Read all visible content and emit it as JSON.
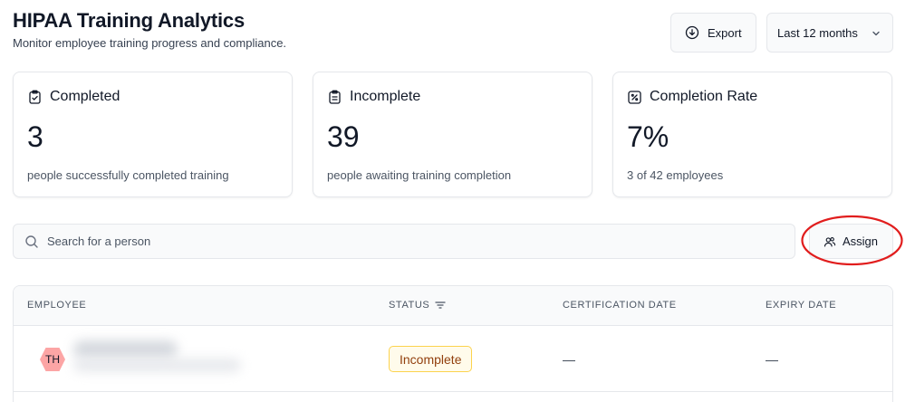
{
  "header": {
    "title": "HIPAA Training Analytics",
    "subtitle": "Monitor employee training progress and compliance."
  },
  "toolbar": {
    "export_label": "Export",
    "date_range": {
      "selected": "Last 12 months"
    }
  },
  "stats": [
    {
      "title": "Completed",
      "value": "3",
      "caption": "people successfully completed training",
      "icon": "clipboard-check-icon"
    },
    {
      "title": "Incomplete",
      "value": "39",
      "caption": "people awaiting training completion",
      "icon": "clipboard-list-icon"
    },
    {
      "title": "Completion Rate",
      "value": "7%",
      "caption": "3 of 42 employees",
      "icon": "percent-square-icon"
    }
  ],
  "search": {
    "placeholder": "Search for a person",
    "value": ""
  },
  "assign": {
    "label": "Assign"
  },
  "annotation": {
    "color": "#e11d1d"
  },
  "table": {
    "columns": [
      "EMPLOYEE",
      "STATUS",
      "CERTIFICATION DATE",
      "EXPIRY DATE"
    ],
    "rows": [
      {
        "initials": "TH",
        "status": "Incomplete",
        "certification_date": "—",
        "expiry_date": "—"
      }
    ]
  },
  "colors": {
    "avatar_fill": "#fca5a5",
    "badge_bg": "#fffbeb",
    "badge_border": "#fcd34d",
    "badge_text": "#92400e"
  }
}
